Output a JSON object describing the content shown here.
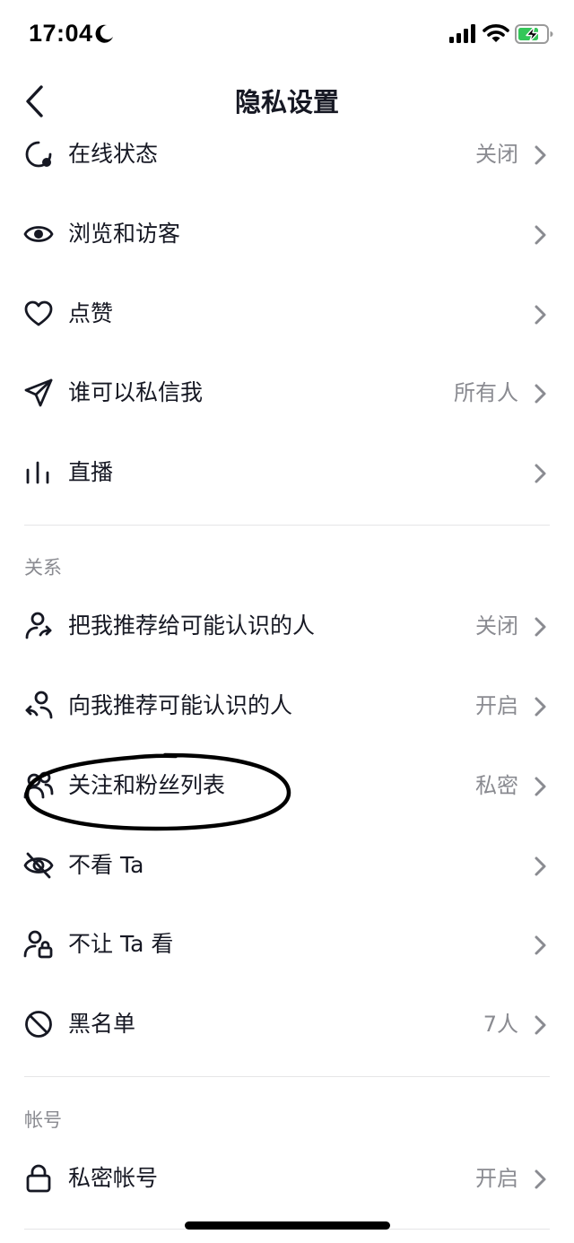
{
  "status_bar": {
    "time": "17:04"
  },
  "header": {
    "title": "隐私设置"
  },
  "main": {
    "rows": [
      {
        "icon": "online-status-icon",
        "label": "在线状态",
        "value": "关闭"
      },
      {
        "icon": "eye-icon",
        "label": "浏览和访客",
        "value": ""
      },
      {
        "icon": "heart-icon",
        "label": "点赞",
        "value": ""
      },
      {
        "icon": "paper-plane-icon",
        "label": "谁可以私信我",
        "value": "所有人"
      },
      {
        "icon": "live-bars-icon",
        "label": "直播",
        "value": ""
      }
    ]
  },
  "relations": {
    "header": "关系",
    "rows": [
      {
        "icon": "user-share-icon",
        "label": "把我推荐给可能认识的人",
        "value": "关闭"
      },
      {
        "icon": "user-recommend-icon",
        "label": "向我推荐可能认识的人",
        "value": "开启"
      },
      {
        "icon": "users-icon",
        "label": "关注和粉丝列表",
        "value": "私密"
      },
      {
        "icon": "eye-off-icon",
        "label": "不看 Ta",
        "value": ""
      },
      {
        "icon": "user-lock-icon",
        "label": "不让 Ta 看",
        "value": ""
      },
      {
        "icon": "block-icon",
        "label": "黑名单",
        "value": "7人"
      }
    ]
  },
  "account": {
    "header": "帐号",
    "rows": [
      {
        "icon": "lock-icon",
        "label": "私密帐号",
        "value": "开启"
      }
    ]
  },
  "colors": {
    "text_primary": "#161823",
    "text_secondary": "#8a8b91",
    "divider": "#e5e5e7",
    "battery_charge": "#34c759"
  }
}
